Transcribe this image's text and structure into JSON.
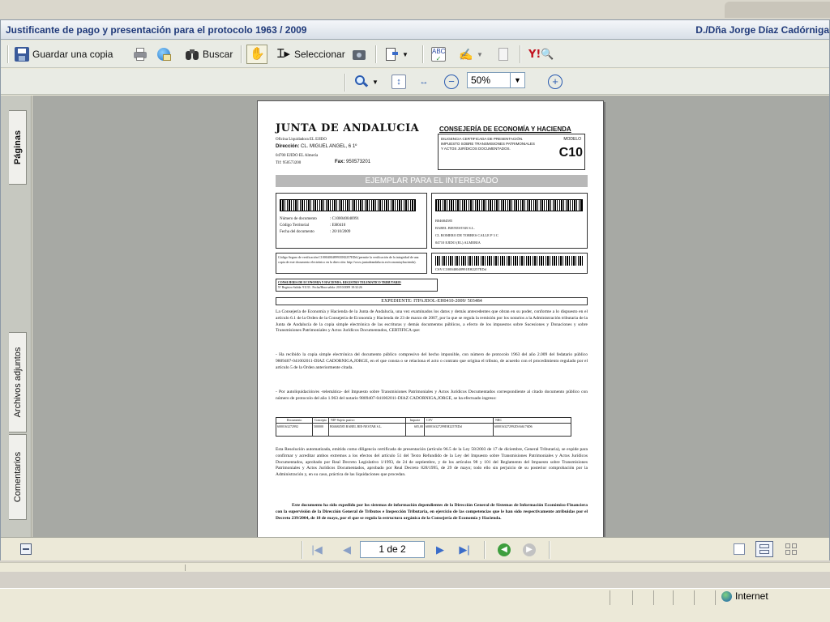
{
  "window": {
    "title": "Justificante de pago y presentación para el protocolo 1963 / 2009",
    "user": "D./Dña Jorge Díaz Cadórniga"
  },
  "toolbar": {
    "save_copy_label": "Guardar una copia",
    "search_label": "Buscar",
    "select_label": "Seleccionar"
  },
  "zoom": {
    "value": "50%"
  },
  "side_tabs": [
    "Páginas",
    "Archivos adjuntos",
    "Comentarios"
  ],
  "pagination": {
    "label": "1 de 2"
  },
  "status": {
    "zone": "Internet"
  },
  "document": {
    "org": "JUNTA DE ANDALUCIA",
    "office_1": "Oficina Liquidadora EL EJIDO",
    "office_addr_label": "Dirección:",
    "office_addr": "CL. MIGUEL ANGEL, 6 1º",
    "office_city": "04700 EJIDO EL Almería",
    "office_tel": "Tlf: 950573200",
    "office_fax_label": "Fax:",
    "office_fax": "950573201",
    "consejeria": "CONSEJERÍA DE ECONOMÍA Y HACIENDA",
    "diligencia": "DILIGENCIA CERTIFICADA DE PRESENTACIÓN. IMPUESTO SOBRE TRANSMISIONES PATRIMONIALES Y ACTOS JURÍDICOS DOCUMENTADOS.",
    "modelo_label": "MODELO",
    "modelo_code": "C10",
    "banner": "EJEMPLAR PARA EL INTERESADO",
    "doc_fields": [
      {
        "label": "Número de documento",
        "value": ": C100040048991"
      },
      {
        "label": "Código Territorial",
        "value": ": EH0410"
      },
      {
        "label": "Fecha del documento",
        "value": ": 20/10/2009"
      }
    ],
    "recipient": [
      "B04684585",
      "BABEL BIENESTAR S.L.",
      "CL ROMERO DE TORRES CALLE P 3 C",
      "04710 EJIDO (EL) ALMERIA"
    ],
    "verify_text": "Código Seguro de verificación:C100040048991EH2257EDd (permite la verificación de la integridad de una copia de este documento electrónico en la dirección: http://www.juntadeandalucia.es/economiayhacienda).",
    "csv_text": "CSV:C100040048991EH2257EDd",
    "registry_line1": "CONSEJERIA DE ECONOMIA Y HACIENDA. REGISTRO TELEMATICO TRIBUTARIO",
    "registry_line2": "Nº Registro Salida: 91133 . Fecha/Hora salida: 20/10/2009 18:32:26",
    "expediente": "EXPEDIENTE: ITPAJDOL-EH0410-2009/ 503484",
    "para1": "La Consejería de Economía y Hacienda de la Junta de Andalucía, una vez examinados los datos y demás antecedentes que obran en su poder, conforme a lo dispuesto en el artículo 6.1 de la Orden de la Consejería de Economía y Hacienda de 23 de marzo de 2007, por la que se regula la remisión por los notarios a la Administración tributaria de la Junta de Andalucía de la copia simple electrónica de las escrituras y demás documentos públicos, a efecto de los impuestos sobre Sucesiones y Donaciones y sobre Transmisiones Patrimoniales y Actos Jurídicos Documentados, CERTIFICA que:",
    "para2": "- Ha recibido la copia simple electrónica del documento público compresivo del hecho imponible, con número de protocolo 1963 del año 2.009 del fedatario público 9809407-041002011-DIAZ CADORNIGA,JORGE, en el que consta o se relaciona el acto o contrato que origina el tributo, de acuerdo con el procedimiento regulado por el artículo 5 de la Orden anteriormente citada.",
    "para3": "- Por autoliquidación/es -telemática- del Impuesto sobre Transmisiones Patrimoniales y Actos Jurídicos Documentados correspondiente al citado documento público con número de protocolo del año 1.963 del notario 9809407-041002011-DIAZ CADORNIGA,JORGE, se ha efectuado ingreso:",
    "table_headers": [
      "Documento",
      "Concepto",
      "NIF-Sujeto pasivo",
      "Importe",
      "CSV",
      "NRC"
    ],
    "table_rows": [
      [
        "6000163272992",
        "500000",
        "B04684585 BABEL BIE-NESTAR S.L.",
        "605,00",
        "600016327299EH2257EDd",
        "6000163272992DA66176D6"
      ]
    ],
    "para4": "Esta Resolución automatizada, emitida como diligencia certificada de presentación (artículo 96.5 de la Ley 58/2003 de 17 de diciembre, General Tributaria), se expide para confirmar y acreditar ambos extremos a los efectos del artículo 51 del Texto Refundido de la Ley del Impuesto sobre Transmisiones Patrimoniales y Actos Jurídicos Documentados, aprobado por Real Decreto Legislativo 1/1993, de 24 de septiembre, y de los artículos 98 y 101 del Reglamento del Impuesto sobre Transmisiones Patrimoniales y Actos Jurídicos Documentados, aprobado por Real Decreto 828/1995, de 29 de mayo; todo ello sin perjuicio de su posterior comprobación por la Administración y, en su caso, práctica de las liquidaciones que procedan.",
    "para5": "Este documento ha sido expedido por los sistemas de información dependientes de la Dirección General de Sistemas de Información Económico-Financiera con la supervisión de la Dirección General de Tributos e Inspección Tributaria, en ejercicio de las competencias que le han sido respectivamente atribuidas por el Decreto 239/2004, de 18 de mayo, por el que se regula la estructura orgánica de la Consejería de Economía y Hacienda."
  }
}
